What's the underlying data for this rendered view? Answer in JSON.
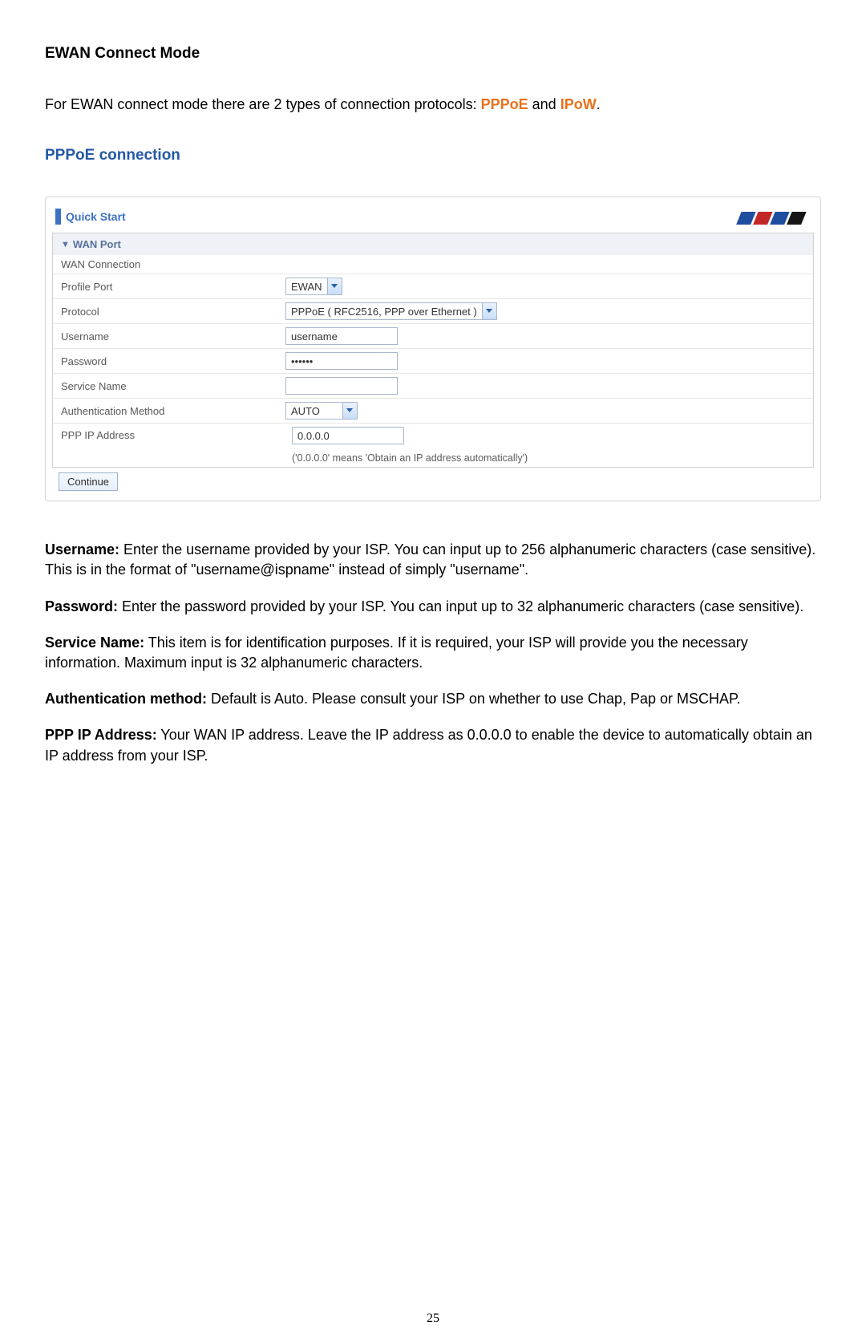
{
  "headings": {
    "ewan_mode": "EWAN Connect Mode",
    "pppoe_conn": "PPPoE connection"
  },
  "intro": {
    "prefix": "For EWAN connect mode there are 2 types of connection protocols: ",
    "protocol1": "PPPoE",
    "mid": " and ",
    "protocol2": "IPoW",
    "suffix": "."
  },
  "panel": {
    "quick_start_title": "Quick Start",
    "wan_port_header": "WAN Port",
    "wan_connection_label": "WAN Connection",
    "rows": {
      "profile_port": {
        "label": "Profile Port",
        "value": "EWAN"
      },
      "protocol": {
        "label": "Protocol",
        "value": "PPPoE ( RFC2516, PPP over Ethernet )"
      },
      "username": {
        "label": "Username",
        "value": "username"
      },
      "password": {
        "label": "Password",
        "value": "••••••"
      },
      "service_name": {
        "label": "Service Name",
        "value": ""
      },
      "auth_method": {
        "label": "Authentication Method",
        "value": "AUTO"
      },
      "ppp_ip": {
        "label": "PPP IP Address",
        "value": "0.0.0.0",
        "note": "('0.0.0.0' means 'Obtain an IP address automatically')"
      }
    },
    "continue_label": "Continue"
  },
  "descriptions": {
    "username_label": "Username:",
    "username_text": " Enter the username provided by your ISP. You can input up to 256 alphanumeric characters (case sensitive). This is in the format of \"username@ispname\" instead of simply \"username\".",
    "password_label": "Password:",
    "password_text": " Enter the password provided by your ISP. You can input up to 32 alphanumeric characters (case sensitive).",
    "service_label": "Service Name:",
    "service_text": " This item is for identification purposes. If it is required, your ISP will provide you the necessary information. Maximum input is 32 alphanumeric characters.",
    "auth_label": "Authentication method:",
    "auth_text": " Default is Auto. Please consult your ISP on whether to use Chap, Pap or MSCHAP.",
    "ppp_label": "PPP IP Address:",
    "ppp_text": " Your WAN IP address. Leave the IP address as 0.0.0.0 to enable the device to automatically obtain an IP address from your ISP."
  },
  "page_number": "25"
}
